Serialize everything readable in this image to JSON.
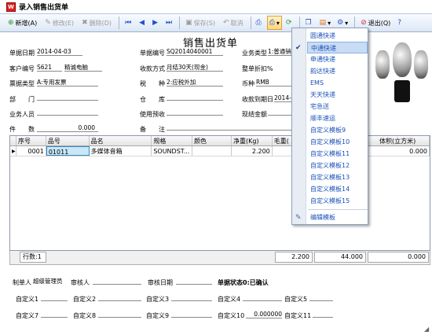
{
  "window": {
    "title": "录入销售出货单",
    "icon_text": "W"
  },
  "toolbar": {
    "new": "新增(A)",
    "edit": "修改(E)",
    "delete": "删除(D)",
    "save": "保存(S)",
    "cancel": "取消",
    "exit": "退出(Q)"
  },
  "form": {
    "title": "销售出货单",
    "date_label": "单据日期",
    "date_value": "2014-04-03",
    "doc_no_label": "单据编号",
    "doc_no_value": "SQ2014040001",
    "biz_type_label": "业务类型",
    "biz_type_value": "1:普通销",
    "customer_label": "客户编号",
    "customer_code": "S621",
    "customer_name": "精诚电脑",
    "payment_label": "收款方式",
    "payment_value": "月结30天(现金)",
    "discount_label": "整单折扣%",
    "invoice_label": "票据类型",
    "invoice_value": "A:专用发票",
    "tax_label": "税　　种",
    "tax_value": "2:应税外加",
    "currency_label": "币种",
    "currency_value": "RMB",
    "dept_label": "部　　门",
    "warehouse_label": "仓　　库",
    "due_label": "收款到期日",
    "due_value": "2014-0",
    "salesman_label": "业务人员",
    "prepay_label": "使用预收",
    "cash_label": "现结金额",
    "qty_label": "件　　数",
    "qty_value": "0.000",
    "remark_label": "备　　注"
  },
  "grid": {
    "headers": [
      "序号",
      "品号",
      "品名",
      "规格",
      "颜色",
      "净重(Kg)",
      "毛重(",
      "体积(立方米)"
    ],
    "rows": [
      {
        "seq": "0001",
        "code": "01011",
        "name": "多媒体音箱",
        "spec": "SOUNDST...",
        "color": "",
        "net": "2.200",
        "gross": "",
        "vol": "0.000"
      }
    ],
    "footer": {
      "rows_label": "行数:1",
      "net_total": "2.200",
      "gross_total": "44.000",
      "vol_total": "0.000"
    }
  },
  "bottom": {
    "maker_label": "制单人",
    "maker_value": "超级管理员",
    "auditor_label": "审核人",
    "audit_date_label": "审核日期",
    "status_label": "单据状态0:已确认",
    "c1": "自定义1",
    "c2": "自定义2",
    "c3": "自定义3",
    "c4": "自定义4",
    "c5": "自定义5",
    "c7": "自定义7",
    "c8": "自定义8",
    "c9": "自定义9",
    "c10": "自定义10",
    "c10_value": "0.000000",
    "c11": "自定义11"
  },
  "dropdown": {
    "items": [
      "圆通快递",
      "中通快递",
      "申通快递",
      "韵达快递",
      "EMS",
      "天天快递",
      "宅急送",
      "顺丰速运",
      "自定义模板9",
      "自定义模板10",
      "自定义模板11",
      "自定义模板12",
      "自定义模板13",
      "自定义模板14",
      "自定义模板15"
    ],
    "checked_index": 1,
    "edit": "编辑模板"
  }
}
